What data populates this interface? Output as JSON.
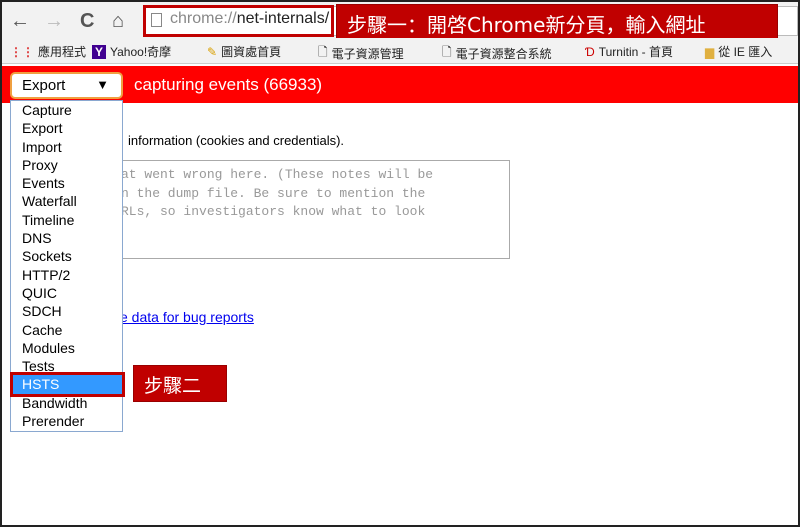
{
  "toolbar": {
    "back": "←",
    "forward": "→",
    "reload": "C",
    "home": "⌂",
    "url_scheme": "chrome://",
    "url_host": "net-internals/"
  },
  "callouts": {
    "step1": "步驟一：開啓Chrome新分頁，輸入網址",
    "step2": "步驟二"
  },
  "bookmarks": [
    "應用程式",
    "Yahoo!奇摩",
    "圖資處首頁",
    "電子資源管理",
    "電子資源整合系統",
    "Turnitin - 首頁",
    "從 IE 匯入"
  ],
  "header": {
    "selected_tab": "Export",
    "status": "capturing events (66933)"
  },
  "menu": {
    "items": [
      "Capture",
      "Export",
      "Import",
      "Proxy",
      "Events",
      "Waterfall",
      "Timeline",
      "DNS",
      "Sockets",
      "HTTP/2",
      "QUIC",
      "SDCH",
      "Cache",
      "Modules",
      "Tests",
      "HSTS",
      "Bandwidth",
      "Prerender"
    ],
    "selected": "HSTS"
  },
  "content": {
    "info_text": "information (cookies and credentials).",
    "textarea_placeholder": "at went wrong here. (These notes will be\nn the dump file. Be sure to mention the\nRLs, so investigators know what to look",
    "link": "e data for bug reports"
  },
  "colors": {
    "accent": "#ff0000",
    "callout": "#c00000",
    "selection": "#3399ff"
  }
}
